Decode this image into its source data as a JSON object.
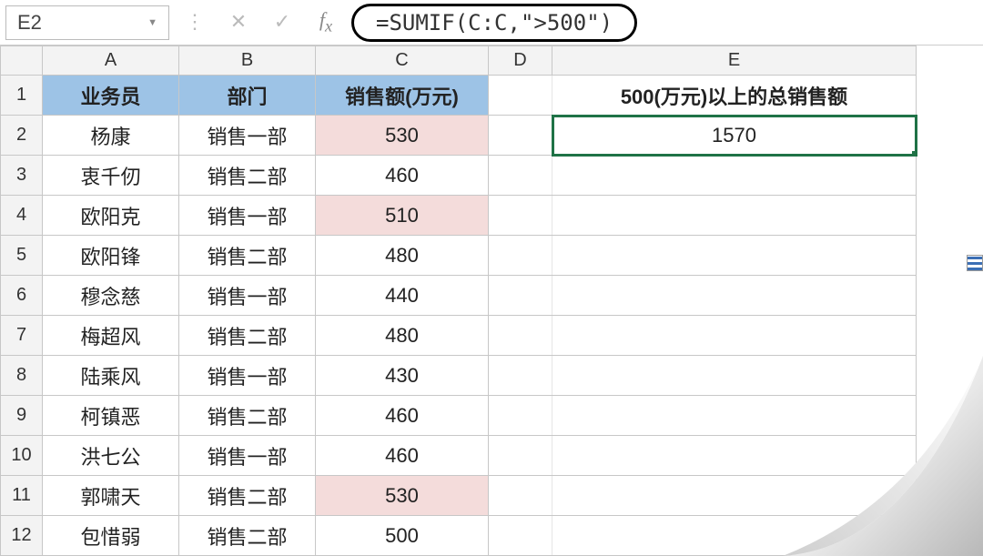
{
  "nameBox": "E2",
  "formula": "=SUMIF(C:C,\">500\")",
  "columns": [
    "A",
    "B",
    "C",
    "D",
    "E"
  ],
  "rowNumbers": [
    "1",
    "2",
    "3",
    "4",
    "5",
    "6",
    "7",
    "8",
    "9",
    "10",
    "11",
    "12"
  ],
  "headers": {
    "A": "业务员",
    "B": "部门",
    "C": "销售额(万元)",
    "E": "500(万元)以上的总销售额"
  },
  "resultE2": "1570",
  "rows": [
    {
      "name": "杨康",
      "dept": "销售一部",
      "sales": "530",
      "hl": true
    },
    {
      "name": "衷千仞",
      "dept": "销售二部",
      "sales": "460",
      "hl": false
    },
    {
      "name": "欧阳克",
      "dept": "销售一部",
      "sales": "510",
      "hl": true
    },
    {
      "name": "欧阳锋",
      "dept": "销售二部",
      "sales": "480",
      "hl": false
    },
    {
      "name": "穆念慈",
      "dept": "销售一部",
      "sales": "440",
      "hl": false
    },
    {
      "name": "梅超风",
      "dept": "销售二部",
      "sales": "480",
      "hl": false
    },
    {
      "name": "陆乘风",
      "dept": "销售一部",
      "sales": "430",
      "hl": false
    },
    {
      "name": "柯镇恶",
      "dept": "销售二部",
      "sales": "460",
      "hl": false
    },
    {
      "name": "洪七公",
      "dept": "销售一部",
      "sales": "460",
      "hl": false
    },
    {
      "name": "郭啸天",
      "dept": "销售二部",
      "sales": "530",
      "hl": true
    },
    {
      "name": "包惜弱",
      "dept": "销售二部",
      "sales": "500",
      "hl": false
    }
  ],
  "chart_data": {
    "type": "table",
    "title": "销售额(万元) — SUMIF 示例",
    "columns": [
      "业务员",
      "部门",
      "销售额(万元)"
    ],
    "rows": [
      [
        "杨康",
        "销售一部",
        530
      ],
      [
        "衷千仞",
        "销售二部",
        460
      ],
      [
        "欧阳克",
        "销售一部",
        510
      ],
      [
        "欧阳锋",
        "销售二部",
        480
      ],
      [
        "穆念慈",
        "销售一部",
        440
      ],
      [
        "梅超风",
        "销售二部",
        480
      ],
      [
        "陆乘风",
        "销售一部",
        430
      ],
      [
        "柯镇恶",
        "销售二部",
        460
      ],
      [
        "洪七公",
        "销售一部",
        460
      ],
      [
        "郭啸天",
        "销售二部",
        530
      ],
      [
        "包惜弱",
        "销售二部",
        500
      ]
    ],
    "derived": {
      "label": "500(万元)以上的总销售额",
      "formula": "=SUMIF(C:C,\">500\")",
      "value": 1570
    }
  }
}
